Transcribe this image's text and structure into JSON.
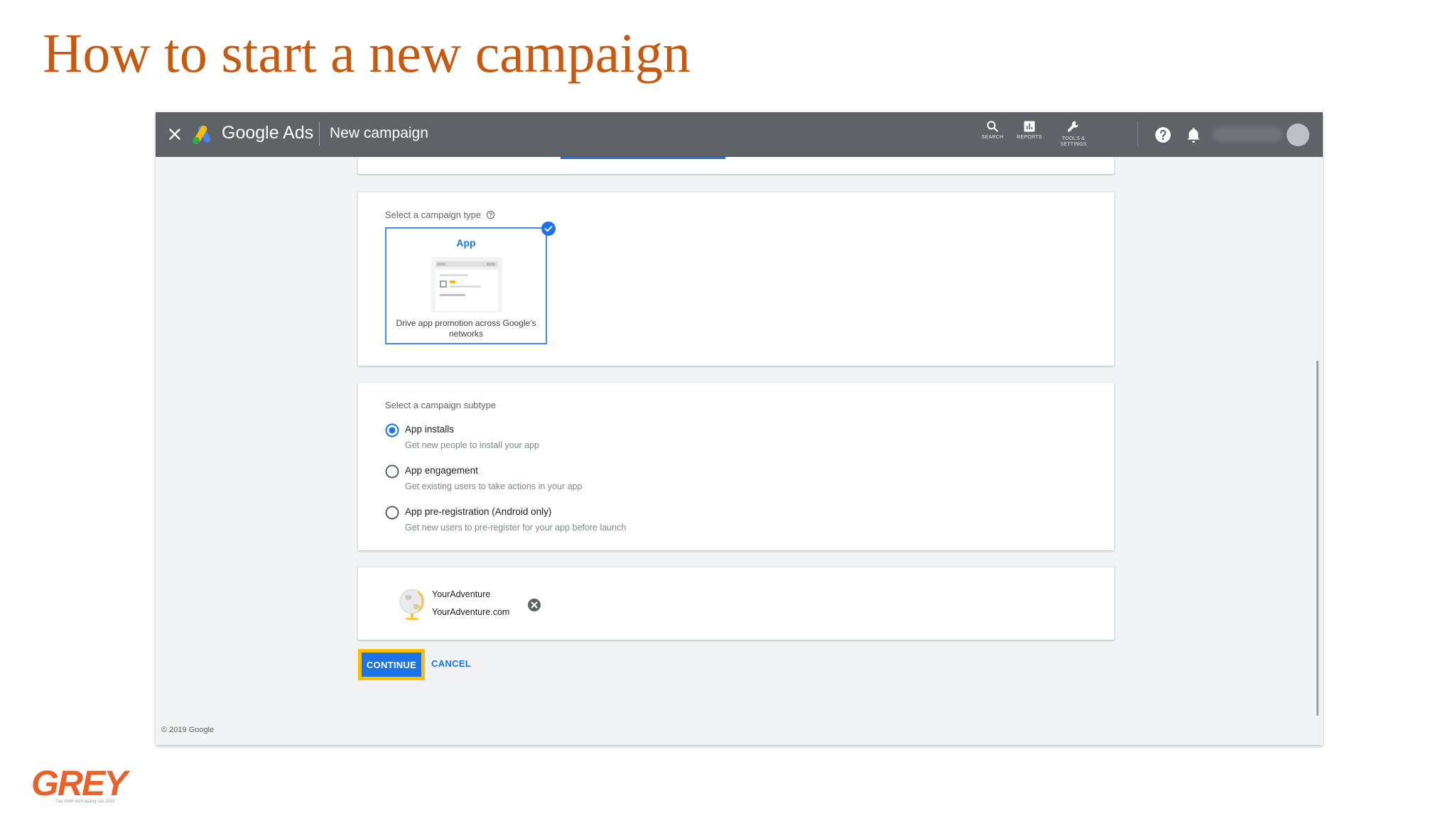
{
  "slide": {
    "title": "How to start a new campaign",
    "logo_text": "GREY",
    "logo_tagline": "Tạo chiến dịch quảng cáo 2019"
  },
  "topbar": {
    "brand": "Google Ads",
    "page_title": "New campaign",
    "tools": [
      {
        "icon": "search-icon",
        "label": "SEARCH"
      },
      {
        "icon": "reports-icon",
        "label": "REPORTS"
      },
      {
        "icon": "wrench-icon",
        "label": "TOOLS & SETTINGS"
      }
    ]
  },
  "campaign_type": {
    "section_label": "Select a campaign type",
    "tile": {
      "name": "App",
      "description": "Drive app promotion across Google's networks",
      "selected": true
    }
  },
  "campaign_subtype": {
    "section_label": "Select a campaign subtype",
    "options": [
      {
        "label": "App installs",
        "description": "Get new people to install your app",
        "selected": true
      },
      {
        "label": "App engagement",
        "description": "Get existing users to take actions in your app",
        "selected": false
      },
      {
        "label": "App pre-registration (Android only)",
        "description": "Get new users to pre-register for your app before launch",
        "selected": false
      }
    ]
  },
  "app": {
    "name": "YourAdventure",
    "url": "YourAdventure.com"
  },
  "actions": {
    "continue_label": "CONTINUE",
    "cancel_label": "CANCEL"
  },
  "footer": {
    "copyright": "© 2019 Google"
  },
  "colors": {
    "title": "#c55a11",
    "topbar": "#5f6368",
    "accent": "#1a73e8",
    "highlight": "#fbbc04",
    "logo": "#e8622c"
  }
}
